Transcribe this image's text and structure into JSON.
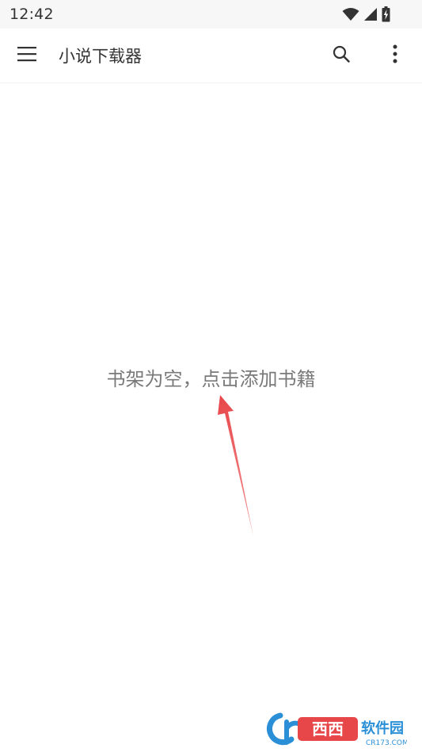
{
  "status_bar": {
    "time": "12:42",
    "icons": [
      "wifi-icon",
      "cellular-signal-icon",
      "battery-charging-icon"
    ]
  },
  "app_bar": {
    "title": "小说下载器",
    "icons": [
      "menu-icon",
      "search-icon",
      "more-vert-icon"
    ]
  },
  "bookshelf": {
    "empty_message": "书架为空，点击添加书籍"
  },
  "annotation": {
    "arrow_color": "#e8474a"
  },
  "watermark": {
    "text": "西西软件园",
    "domain": "CR173.COM"
  }
}
